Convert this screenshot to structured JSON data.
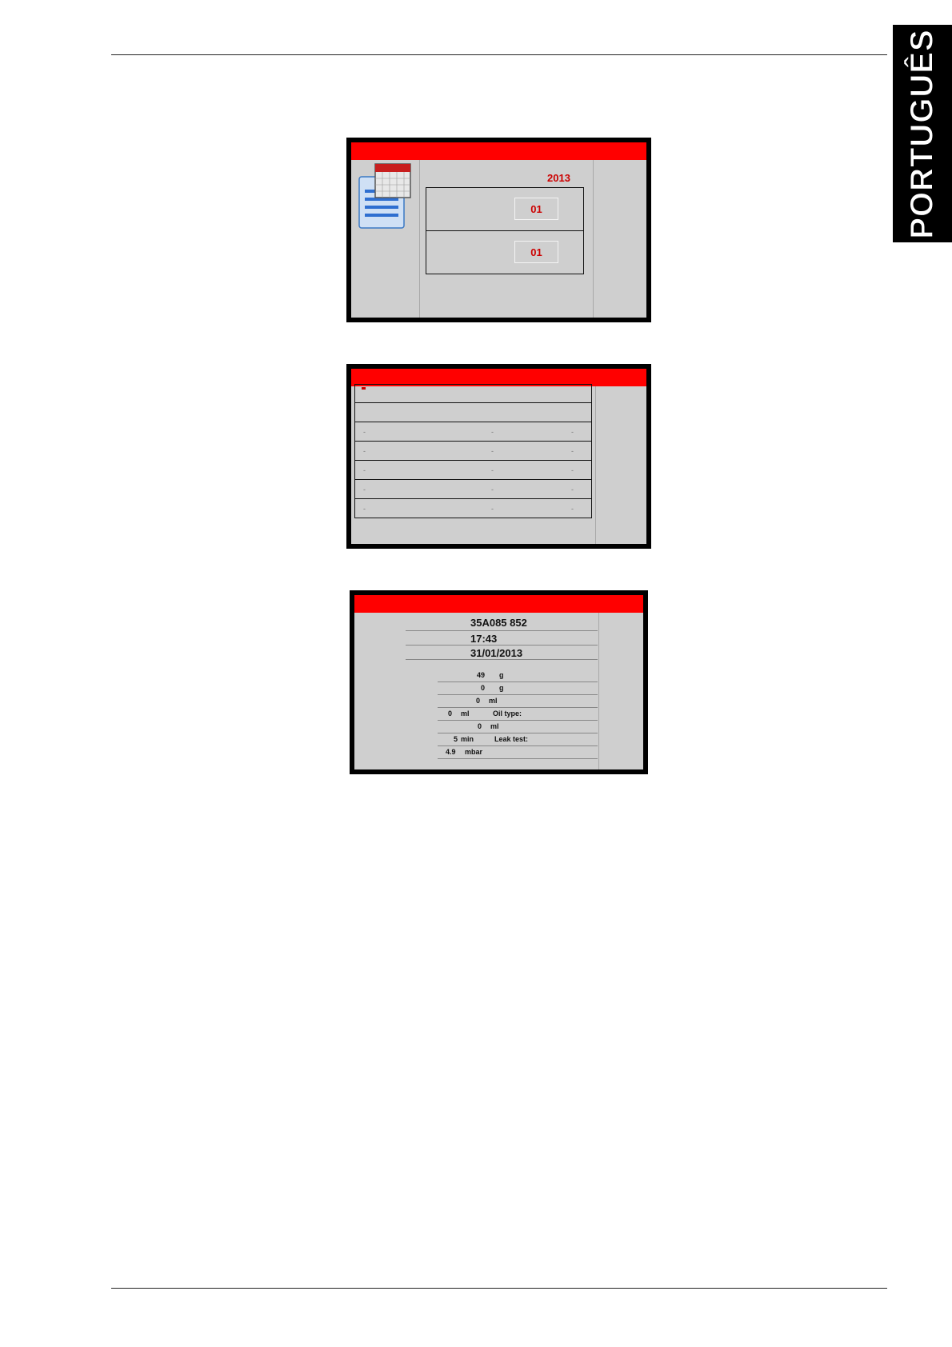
{
  "language_tab": "PORTUGUÊS",
  "screen1": {
    "year": "2013",
    "month_value": "01",
    "day_value": "01"
  },
  "screen2": {
    "rows": [
      {
        "marks": []
      },
      {
        "marks": []
      },
      {
        "marks": [
          "-",
          "-",
          "-"
        ]
      },
      {
        "marks": [
          "-",
          "-",
          "-"
        ]
      },
      {
        "marks": [
          "-",
          "-",
          "-"
        ]
      },
      {
        "marks": [
          "-",
          "-",
          "-"
        ]
      },
      {
        "marks": [
          "-",
          "-",
          "-"
        ]
      }
    ]
  },
  "screen3": {
    "plate": "35A085 852",
    "time": "17:43",
    "date": "31/01/2013",
    "recovered_value": "49",
    "recovered_unit": "g",
    "charged_value": "0",
    "charged_unit": "g",
    "oil_recovered_value": "0",
    "oil_recovered_unit": "ml",
    "oil_injected_value": "0",
    "oil_injected_unit": "ml",
    "oil_type_label": "Oil type:",
    "uv_value": "0",
    "uv_unit": "ml",
    "leak_time_value": "5",
    "leak_time_unit": "min",
    "leak_test_label": "Leak test:",
    "vacuum_value": "4.9",
    "vacuum_unit": "mbar"
  }
}
